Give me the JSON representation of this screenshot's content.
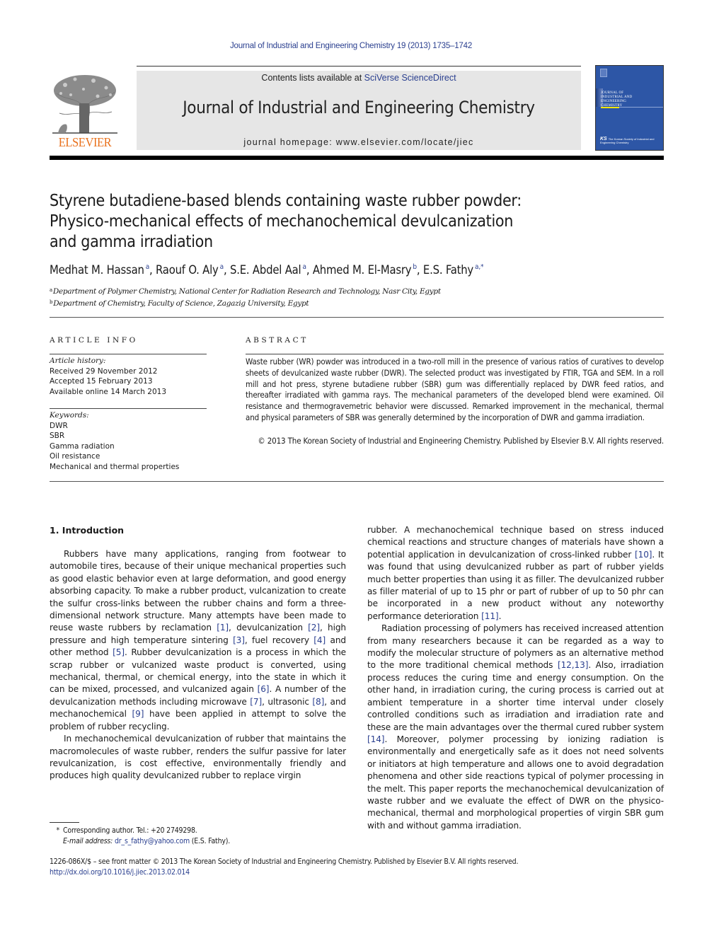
{
  "header": {
    "journal_ref": "Journal of Industrial and Engineering Chemistry 19 (2013) 1735–1742",
    "contents_prefix": "Contents lists available at ",
    "contents_link": "SciVerse ScienceDirect",
    "journal_title": "Journal of Industrial and Engineering Chemistry",
    "homepage": "journal homepage: www.elsevier.com/locate/jiec",
    "publisher_logo_text": "ELSEVIER",
    "cover": {
      "title_lines": [
        "JOURNAL OF",
        "INDUSTRIAL AND",
        "ENGINEERING",
        "CHEMISTRY"
      ],
      "society_text": "The Korean Society of Industrial and Engineering Chemistry",
      "bg_color": "#2d56a6",
      "accent_color": "#f2e600"
    },
    "logo_color": "#e9711c",
    "link_color": "#2a3f8f"
  },
  "article": {
    "title_lines": [
      "Styrene butadiene-based blends containing waste rubber powder:",
      "Physico-mechanical effects of mechanochemical devulcanization",
      "and gamma irradiation"
    ],
    "authors": [
      {
        "name": "Medhat M. Hassan",
        "aff": "a"
      },
      {
        "name": "Raouf O. Aly",
        "aff": "a"
      },
      {
        "name": "S.E. Abdel Aal",
        "aff": "a"
      },
      {
        "name": "Ahmed M. El-Masry",
        "aff": "b"
      },
      {
        "name": "E.S. Fathy",
        "aff": "a,*"
      }
    ],
    "affiliations": [
      {
        "key": "a",
        "text": "Department of Polymer Chemistry, National Center for Radiation Research and Technology, Nasr City, Egypt"
      },
      {
        "key": "b",
        "text": "Department of Chemistry, Faculty of Science, Zagazig University, Egypt"
      }
    ]
  },
  "article_info": {
    "label": "ARTICLE INFO",
    "history_label": "Article history:",
    "history": [
      "Received 29 November 2012",
      "Accepted 15 February 2013",
      "Available online 14 March 2013"
    ],
    "keywords_label": "Keywords:",
    "keywords": [
      "DWR",
      "SBR",
      "Gamma radiation",
      "Oil resistance",
      "Mechanical and thermal properties"
    ]
  },
  "abstract": {
    "label": "ABSTRACT",
    "text": "Waste rubber (WR) powder was introduced in a two-roll mill in the presence of various ratios of curatives to develop sheets of devulcanized waste rubber (DWR). The selected product was investigated by FTIR, TGA and SEM. In a roll mill and hot press, styrene butadiene rubber (SBR) gum was differentially replaced by DWR feed ratios, and thereafter irradiated with gamma rays. The mechanical parameters of the developed blend were examined. Oil resistance and thermogravemetric behavior were discussed. Remarked improvement in the mechanical, thermal and physical parameters of SBR was generally determined by the incorporation of DWR and gamma irradiation.",
    "copyright": "© 2013 The Korean Society of Industrial and Engineering Chemistry. Published by Elsevier B.V. All rights reserved."
  },
  "body": {
    "section_heading": "1. Introduction",
    "left_p1": [
      {
        "t": "Rubbers have many applications, ranging from footwear to automobile tires, because of their unique mechanical properties such as good elastic behavior even at large deformation, and good energy absorbing capacity. To make a rubber product, vulcanization to create the sulfur cross-links between the rubber chains and form a three-dimensional network structure. Many attempts have been made to reuse waste rubbers by reclamation "
      },
      {
        "r": "[1]"
      },
      {
        "t": ", devulcanization "
      },
      {
        "r": "[2]"
      },
      {
        "t": ", high pressure and high temperature sintering "
      },
      {
        "r": "[3]"
      },
      {
        "t": ", fuel recovery "
      },
      {
        "r": "[4]"
      },
      {
        "t": " and other method "
      },
      {
        "r": "[5]"
      },
      {
        "t": ". Rubber devulcanization is a process in which the scrap rubber or vulcanized waste product is converted, using mechanical, thermal, or chemical energy, into the state in which it can be mixed, processed, and vulcanized again "
      },
      {
        "r": "[6]"
      },
      {
        "t": ". A number of the devulcanization methods including microwave "
      },
      {
        "r": "[7]"
      },
      {
        "t": ", ultrasonic "
      },
      {
        "r": "[8]"
      },
      {
        "t": ", and mechanochemical "
      },
      {
        "r": "[9]"
      },
      {
        "t": " have been applied in attempt to solve the problem of rubber recycling."
      }
    ],
    "left_p2": [
      {
        "t": "In mechanochemical devulcanization of rubber that maintains the macromolecules of waste rubber, renders the sulfur passive for later revulcanization, is cost effective, environmentally friendly and produces high quality devulcanized rubber to replace virgin"
      }
    ],
    "right_p1": [
      {
        "t": "rubber. A mechanochemical technique based on stress induced chemical reactions and structure changes of materials have shown a potential application in devulcanization of cross-linked rubber "
      },
      {
        "r": "[10]"
      },
      {
        "t": ". It was found that using devulcanized rubber as part of rubber yields much better properties than using it as filler. The devulcanized rubber as filler material of up to 15 phr or part of rubber of up to 50 phr can be incorporated in a new product without any noteworthy performance deterioration "
      },
      {
        "r": "[11]"
      },
      {
        "t": "."
      }
    ],
    "right_p2": [
      {
        "t": "Radiation processing of polymers has received increased attention from many researchers because it can be regarded as a way to modify the molecular structure of polymers as an alternative method to the more traditional chemical methods "
      },
      {
        "r": "[12,13]"
      },
      {
        "t": ". Also, irradiation process reduces the curing time and energy consumption. On the other hand, in irradiation curing, the curing process is carried out at ambient temperature in a shorter time interval under closely controlled conditions such as irradiation and irradiation rate and these are the main advantages over the thermal cured rubber system "
      },
      {
        "r": "[14]"
      },
      {
        "t": ". Moreover, polymer processing by ionizing radiation is environmentally and energetically safe as it does not need solvents or initiators at high temperature and allows one to avoid degradation phenomena and other side reactions typical of polymer processing in the melt. This paper reports the mechanochemical devulcanization of waste rubber and we evaluate the effect of DWR on the physico-mechanical, thermal and morphological properties of virgin SBR gum with and without gamma irradiation."
      }
    ]
  },
  "footnote": {
    "star": "*",
    "corresponding": "Corresponding author. Tel.: +20 2749298.",
    "email_label": "E-mail address:",
    "email": "dr_s_fathy@yahoo.com",
    "email_suffix": " (E.S. Fathy)."
  },
  "front_matter": {
    "issn_line": "1226-086X/$ – see front matter © 2013 The Korean Society of Industrial and Engineering Chemistry. Published by Elsevier B.V. All rights reserved.",
    "doi": "http://dx.doi.org/10.1016/j.jiec.2013.02.014"
  }
}
